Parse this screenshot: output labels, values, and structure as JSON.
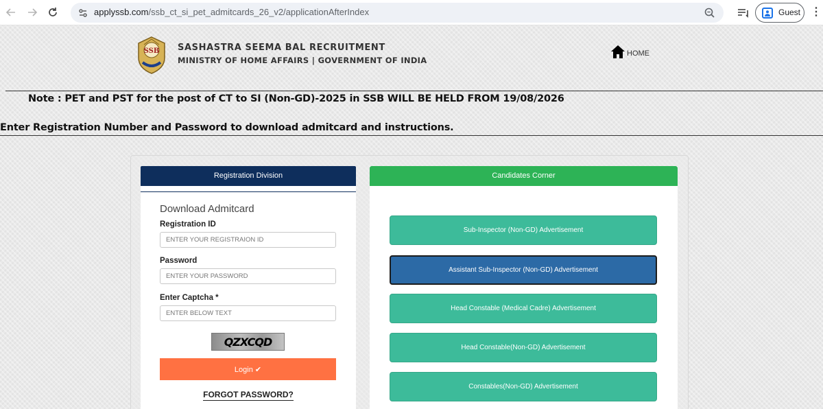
{
  "browser": {
    "url_domain": "applyssb.com",
    "url_path": "/ssb_ct_si_pet_admitcards_26_v2/applicationAfterIndex",
    "profile_label": "Guest",
    "back_icon": "arrow-left-icon",
    "forward_icon": "arrow-right-icon",
    "reload_icon": "reload-icon",
    "site_info_icon": "tune-icon",
    "zoom_icon": "zoom-icon",
    "tab_search_icon": "tab-search-icon",
    "menu_icon": "kebab-menu-icon"
  },
  "header": {
    "org_name": "SASHASTRA SEEMA BAL RECRUITMENT",
    "ministry": "MINISTRY OF HOME AFFAIRS | GOVERNMENT OF INDIA",
    "logo_text": "SSB",
    "home_label": "HOME"
  },
  "notice": {
    "note": "Note : PET and PST for the post of CT to SI (Non-GD)-2025 in SSB WILL BE HELD FROM 19/08/2026",
    "instruction": "Enter Registration Number and Password to download admitcard and instructions."
  },
  "registration": {
    "header": "Registration Division",
    "form_title": "Download Admitcard",
    "reg_id_label": "Registration ID",
    "reg_id_placeholder": "ENTER YOUR REGISTRAION ID",
    "password_label": "Password",
    "password_placeholder": "ENTER YOUR PASSWORD",
    "captcha_label": "Enter Captcha *",
    "captcha_placeholder": "ENTER BELOW TEXT",
    "captcha_text": "QZXCQD",
    "login_label": "Login ✔",
    "forgot_label": "FORGOT PASSWORD?"
  },
  "candidates": {
    "header": "Candidates Corner",
    "buttons": [
      "Sub-Inspector (Non-GD) Advertisement",
      "Assistant Sub-Inspector (Non-GD) Advertisement",
      "Head Constable (Medical Cadre) Advertisement",
      "Head Constable(Non-GD) Advertisement",
      "Constables(Non-GD) Advertisement"
    ]
  },
  "colors": {
    "registration_header": "#0e2e5c",
    "candidates_header": "#2db356",
    "advert_button": "#3dbb9a",
    "advert_button_active": "#2c6aa6",
    "login_button": "#ff7142"
  }
}
